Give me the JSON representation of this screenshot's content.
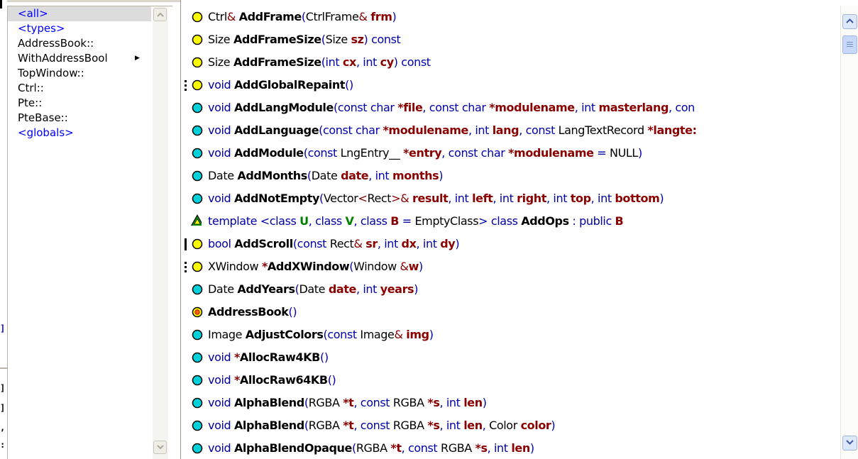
{
  "scope_panel": {
    "items": [
      {
        "label": "<all>",
        "style": "blue",
        "selected": true
      },
      {
        "label": "<types>",
        "style": "blue",
        "selected": false
      },
      {
        "label": "AddressBook::",
        "style": "black",
        "selected": false
      },
      {
        "label": "WithAddressBool",
        "style": "black",
        "selected": false,
        "has_submenu": true
      },
      {
        "label": "TopWindow::",
        "style": "black",
        "selected": false
      },
      {
        "label": "Ctrl::",
        "style": "black",
        "selected": false
      },
      {
        "label": "Pte::",
        "style": "black",
        "selected": false
      },
      {
        "label": "PteBase::",
        "style": "black",
        "selected": false
      },
      {
        "label": "<globals>",
        "style": "blue",
        "selected": false
      }
    ]
  },
  "member_list": {
    "rows": [
      {
        "icon": "yellow-circle-icon",
        "deco": "",
        "tokens": [
          [
            "ty",
            "Ctrl"
          ],
          [
            "op",
            "& "
          ],
          [
            "nm",
            "AddFrame"
          ],
          [
            "kw",
            "("
          ],
          [
            "ty",
            "CtrlFrame"
          ],
          [
            "op",
            "& "
          ],
          [
            "pr",
            "frm"
          ],
          [
            "kw",
            ")"
          ]
        ]
      },
      {
        "icon": "yellow-circle-icon",
        "deco": "",
        "tokens": [
          [
            "ty",
            "Size "
          ],
          [
            "nm",
            "AddFrameSize"
          ],
          [
            "kw",
            "("
          ],
          [
            "ty",
            "Size "
          ],
          [
            "pr",
            "sz"
          ],
          [
            "kw",
            ") const"
          ]
        ]
      },
      {
        "icon": "yellow-circle-icon",
        "deco": "",
        "tokens": [
          [
            "ty",
            "Size "
          ],
          [
            "nm",
            "AddFrameSize"
          ],
          [
            "kw",
            "(int "
          ],
          [
            "pr",
            "cx"
          ],
          [
            "kw",
            ", int "
          ],
          [
            "pr",
            "cy"
          ],
          [
            "kw",
            ") const"
          ]
        ]
      },
      {
        "icon": "yellow-circle-icon",
        "deco": "dots",
        "tokens": [
          [
            "kw",
            "void "
          ],
          [
            "nm",
            "AddGlobalRepaint"
          ],
          [
            "kw",
            "()"
          ]
        ]
      },
      {
        "icon": "cyan-circle-icon",
        "deco": "",
        "tokens": [
          [
            "kw",
            "void "
          ],
          [
            "nm",
            "AddLangModule"
          ],
          [
            "kw",
            "(const char "
          ],
          [
            "dk",
            "*file"
          ],
          [
            "kw",
            ", const char "
          ],
          [
            "dk",
            "*modulename"
          ],
          [
            "kw",
            ", int "
          ],
          [
            "pr",
            "masterlang"
          ],
          [
            "kw",
            ", con"
          ]
        ]
      },
      {
        "icon": "cyan-circle-icon",
        "deco": "",
        "tokens": [
          [
            "kw",
            "void "
          ],
          [
            "nm",
            "AddLanguage"
          ],
          [
            "kw",
            "(const char "
          ],
          [
            "dk",
            "*modulename"
          ],
          [
            "kw",
            ", int "
          ],
          [
            "pr",
            "lang"
          ],
          [
            "kw",
            ", const "
          ],
          [
            "ty",
            "LangTextRecord "
          ],
          [
            "dk",
            "*langte:"
          ]
        ]
      },
      {
        "icon": "cyan-circle-icon",
        "deco": "",
        "tokens": [
          [
            "kw",
            "void "
          ],
          [
            "nm",
            "AddModule"
          ],
          [
            "kw",
            "(const "
          ],
          [
            "ty",
            "LngEntry__ "
          ],
          [
            "dk",
            "*entry"
          ],
          [
            "kw",
            ", const char "
          ],
          [
            "dk",
            "*modulename"
          ],
          [
            "kw",
            " = "
          ],
          [
            "ty",
            "NULL"
          ],
          [
            "kw",
            ")"
          ]
        ]
      },
      {
        "icon": "cyan-circle-icon",
        "deco": "",
        "tokens": [
          [
            "ty",
            "Date "
          ],
          [
            "nm",
            "AddMonths"
          ],
          [
            "kw",
            "("
          ],
          [
            "ty",
            "Date "
          ],
          [
            "pr",
            "date"
          ],
          [
            "kw",
            ", int "
          ],
          [
            "pr",
            "months"
          ],
          [
            "kw",
            ")"
          ]
        ]
      },
      {
        "icon": "cyan-circle-icon",
        "deco": "",
        "tokens": [
          [
            "kw",
            "void "
          ],
          [
            "nm",
            "AddNotEmpty"
          ],
          [
            "kw",
            "("
          ],
          [
            "ty",
            "Vector"
          ],
          [
            "op",
            "<"
          ],
          [
            "ty",
            "Rect"
          ],
          [
            "op",
            ">& "
          ],
          [
            "pr",
            "result"
          ],
          [
            "kw",
            ", int "
          ],
          [
            "pr",
            "left"
          ],
          [
            "kw",
            ", int "
          ],
          [
            "pr",
            "right"
          ],
          [
            "kw",
            ", int "
          ],
          [
            "pr",
            "top"
          ],
          [
            "kw",
            ", int "
          ],
          [
            "pr",
            "bottom"
          ],
          [
            "kw",
            ")"
          ]
        ]
      },
      {
        "icon": "green-triangle-icon",
        "deco": "",
        "tokens": [
          [
            "kw",
            "template <class "
          ],
          [
            "gn",
            "U"
          ],
          [
            "kw",
            ", class "
          ],
          [
            "gn",
            "V"
          ],
          [
            "kw",
            ", class "
          ],
          [
            "pr",
            "B"
          ],
          [
            "kw",
            " = "
          ],
          [
            "ty",
            "EmptyClass"
          ],
          [
            "kw",
            ">  class "
          ],
          [
            "nm",
            "AddOps"
          ],
          [
            "kw",
            " : public "
          ],
          [
            "pr",
            "B"
          ]
        ]
      },
      {
        "icon": "yellow-circle-icon",
        "deco": "bar",
        "tokens": [
          [
            "kw",
            "bool "
          ],
          [
            "nm",
            "AddScroll"
          ],
          [
            "kw",
            "(const "
          ],
          [
            "ty",
            "Rect"
          ],
          [
            "op",
            "& "
          ],
          [
            "pr",
            "sr"
          ],
          [
            "kw",
            ", int "
          ],
          [
            "pr",
            "dx"
          ],
          [
            "kw",
            ", int "
          ],
          [
            "pr",
            "dy"
          ],
          [
            "kw",
            ")"
          ]
        ]
      },
      {
        "icon": "yellow-circle-icon",
        "deco": "dots",
        "tokens": [
          [
            "ty",
            "XWindow "
          ],
          [
            "dk",
            "*"
          ],
          [
            "nm",
            "AddXWindow"
          ],
          [
            "kw",
            "("
          ],
          [
            "ty",
            "Window "
          ],
          [
            "op",
            "&"
          ],
          [
            "pr",
            "w"
          ],
          [
            "kw",
            ")"
          ]
        ]
      },
      {
        "icon": "cyan-circle-icon",
        "deco": "",
        "tokens": [
          [
            "ty",
            "Date "
          ],
          [
            "nm",
            "AddYears"
          ],
          [
            "kw",
            "("
          ],
          [
            "ty",
            "Date "
          ],
          [
            "pr",
            "date"
          ],
          [
            "kw",
            ", int "
          ],
          [
            "pr",
            "years"
          ],
          [
            "kw",
            ")"
          ]
        ]
      },
      {
        "icon": "constructor-icon",
        "deco": "",
        "tokens": [
          [
            "nm",
            "AddressBook"
          ],
          [
            "kw",
            "()"
          ]
        ]
      },
      {
        "icon": "cyan-circle-icon",
        "deco": "",
        "tokens": [
          [
            "ty",
            "Image "
          ],
          [
            "nm",
            "AdjustColors"
          ],
          [
            "kw",
            "(const "
          ],
          [
            "ty",
            "Image"
          ],
          [
            "op",
            "& "
          ],
          [
            "pr",
            "img"
          ],
          [
            "kw",
            ")"
          ]
        ]
      },
      {
        "icon": "cyan-circle-icon",
        "deco": "",
        "tokens": [
          [
            "kw",
            "void "
          ],
          [
            "dk",
            "*"
          ],
          [
            "nm",
            "AllocRaw4KB"
          ],
          [
            "kw",
            "()"
          ]
        ]
      },
      {
        "icon": "cyan-circle-icon",
        "deco": "",
        "tokens": [
          [
            "kw",
            "void "
          ],
          [
            "dk",
            "*"
          ],
          [
            "nm",
            "AllocRaw64KB"
          ],
          [
            "kw",
            "()"
          ]
        ]
      },
      {
        "icon": "cyan-circle-icon",
        "deco": "",
        "tokens": [
          [
            "kw",
            "void "
          ],
          [
            "nm",
            "AlphaBlend"
          ],
          [
            "kw",
            "("
          ],
          [
            "ty",
            "RGBA "
          ],
          [
            "dk",
            "*t"
          ],
          [
            "kw",
            ", const "
          ],
          [
            "ty",
            "RGBA "
          ],
          [
            "dk",
            "*s"
          ],
          [
            "kw",
            ", int "
          ],
          [
            "pr",
            "len"
          ],
          [
            "kw",
            ")"
          ]
        ]
      },
      {
        "icon": "cyan-circle-icon",
        "deco": "",
        "tokens": [
          [
            "kw",
            "void "
          ],
          [
            "nm",
            "AlphaBlend"
          ],
          [
            "kw",
            "("
          ],
          [
            "ty",
            "RGBA "
          ],
          [
            "dk",
            "*t"
          ],
          [
            "kw",
            ", const "
          ],
          [
            "ty",
            "RGBA "
          ],
          [
            "dk",
            "*s"
          ],
          [
            "kw",
            ", int "
          ],
          [
            "pr",
            "len"
          ],
          [
            "kw",
            ", "
          ],
          [
            "ty",
            "Color "
          ],
          [
            "pr",
            "color"
          ],
          [
            "kw",
            ")"
          ]
        ]
      },
      {
        "icon": "cyan-circle-icon",
        "deco": "",
        "tokens": [
          [
            "kw",
            "void "
          ],
          [
            "nm",
            "AlphaBlendOpaque"
          ],
          [
            "kw",
            "("
          ],
          [
            "ty",
            "RGBA "
          ],
          [
            "dk",
            "*t"
          ],
          [
            "kw",
            ", const "
          ],
          [
            "ty",
            "RGBA "
          ],
          [
            "dk",
            "*s"
          ],
          [
            "kw",
            ", int "
          ],
          [
            "pr",
            "len"
          ],
          [
            "kw",
            ")"
          ]
        ]
      }
    ]
  },
  "colors": {
    "keyword": "#0000aa",
    "param": "#8b0000",
    "scope_link": "#0000ff",
    "yellow_icon": "#ffff00",
    "cyan_icon": "#00d0d8",
    "template_icon": "#00b000"
  }
}
